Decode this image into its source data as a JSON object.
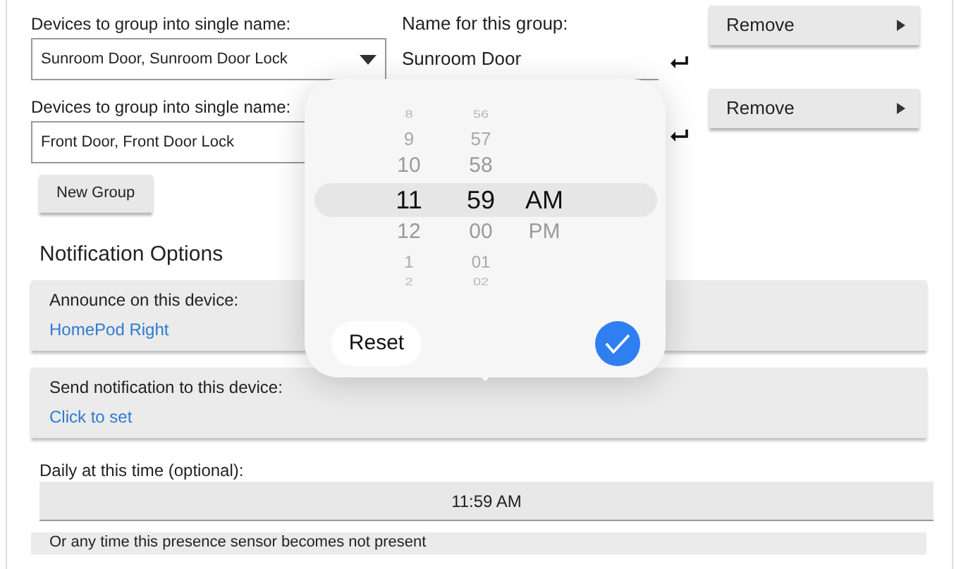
{
  "groups": [
    {
      "devices_label": "Devices to group into single name:",
      "devices_value": "Sunroom Door, Sunroom Door Lock",
      "name_label": "Name for this group:",
      "name_value": "Sunroom Door",
      "remove": "Remove"
    },
    {
      "devices_label": "Devices to group into single name:",
      "devices_value": "Front Door, Front Door Lock",
      "remove": "Remove"
    }
  ],
  "new_group": "New Group",
  "section_title": "Notification Options",
  "cards": [
    {
      "label": "Announce on this device:",
      "value": "HomePod Right"
    },
    {
      "label": "Send notification to this device:",
      "value": "Click to set"
    }
  ],
  "time_label": "Daily at this time (optional):",
  "time_value": "11:59 AM",
  "last_card": {
    "label": "Or any time this presence sensor becomes not present"
  },
  "time_picker": {
    "hours": [
      {
        "text": "8",
        "selected": false
      },
      {
        "text": "9",
        "selected": false
      },
      {
        "text": "10",
        "selected": false
      },
      {
        "text": "11",
        "selected": true
      },
      {
        "text": "12",
        "selected": false
      },
      {
        "text": "1",
        "selected": false
      },
      {
        "text": "2",
        "selected": false
      }
    ],
    "minutes": [
      {
        "text": "56",
        "selected": false
      },
      {
        "text": "57",
        "selected": false
      },
      {
        "text": "58",
        "selected": false
      },
      {
        "text": "59",
        "selected": true
      },
      {
        "text": "00",
        "selected": false
      },
      {
        "text": "01",
        "selected": false
      },
      {
        "text": "02",
        "selected": false
      }
    ],
    "period": [
      {
        "text": "AM",
        "selected": true
      },
      {
        "text": "PM",
        "selected": false
      }
    ],
    "reset": "Reset"
  }
}
